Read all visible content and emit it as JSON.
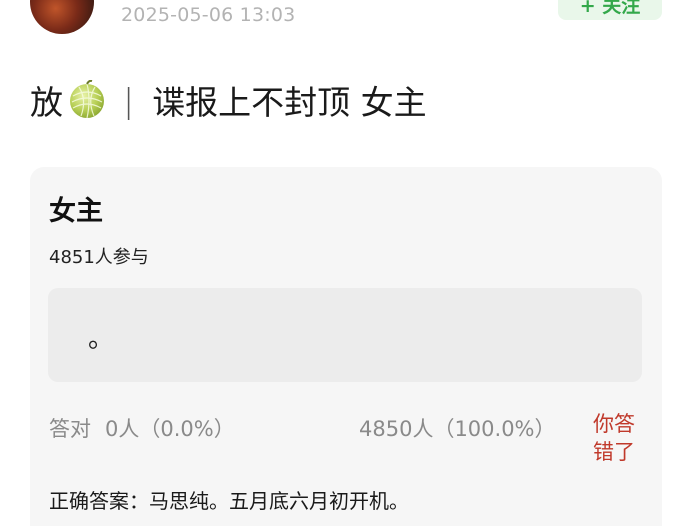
{
  "header": {
    "timestamp": "2025-05-06 13:03",
    "follow_label": "+ 关注"
  },
  "post": {
    "title_prefix": "放",
    "title_icon": "melon-icon",
    "separator": "|",
    "title_text": "谍报上不封顶 女主"
  },
  "poll": {
    "title": "女主",
    "participants": "4851人参与",
    "option_text": "。",
    "correct_label": "答对",
    "correct_stat": "0人（0.0%）",
    "other_stat": "4850人（100.0%）",
    "result_badge": "你答错了",
    "answer": "正确答案：马思纯。五月底六月初开机。",
    "correct_fraction": 0.0,
    "other_fraction": 1.0
  },
  "colors": {
    "accent_green": "#33a84a",
    "wrong_red": "#c0392b",
    "card_bg": "#f6f6f6"
  }
}
